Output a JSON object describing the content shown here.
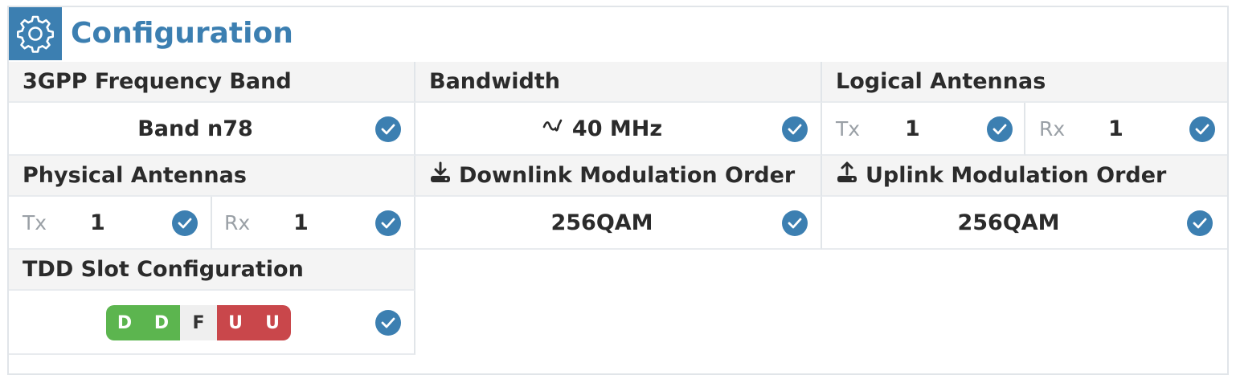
{
  "header": {
    "title": "Configuration",
    "icon": "gear-icon",
    "accent_color": "#3c7fb1"
  },
  "frequency_band": {
    "label": "3GPP Frequency Band",
    "value": "Band n78"
  },
  "bandwidth": {
    "label": "Bandwidth",
    "icon": "signal-wave-icon",
    "value": "40 MHz"
  },
  "logical_antennas": {
    "label": "Logical Antennas",
    "tx_label": "Tx",
    "tx_value": "1",
    "rx_label": "Rx",
    "rx_value": "1"
  },
  "physical_antennas": {
    "label": "Physical Antennas",
    "tx_label": "Tx",
    "tx_value": "1",
    "rx_label": "Rx",
    "rx_value": "1"
  },
  "downlink_modulation": {
    "label": "Downlink Modulation Order",
    "icon": "download-icon",
    "value": "256QAM"
  },
  "uplink_modulation": {
    "label": "Uplink Modulation Order",
    "icon": "upload-icon",
    "value": "256QAM"
  },
  "tdd_slot": {
    "label": "TDD Slot Configuration",
    "slots": [
      "D",
      "D",
      "F",
      "U",
      "U"
    ],
    "colors": {
      "D": "#5cb54f",
      "F": "#efefef",
      "U": "#c9474b"
    }
  },
  "status_icon": "check-circle-icon"
}
